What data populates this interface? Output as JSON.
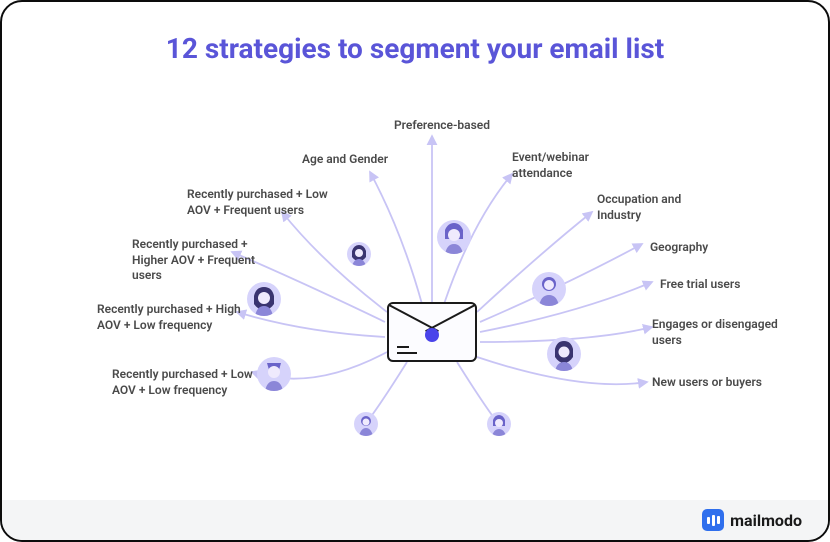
{
  "title": "12 strategies to segment your email list",
  "brand": "mailmodo",
  "colors": {
    "accent": "#5a55d8",
    "avatar_bg": "#d6d3fb",
    "line": "#c8c4f5"
  },
  "strategies": {
    "preference_based": "Preference-based",
    "age_gender": "Age and Gender",
    "recent_low_aov_freq": "Recently purchased + Low AOV + Frequent users",
    "recent_high_aov_freq": "Recently purchased + Higher AOV + Frequent users",
    "recent_high_aov_low": "Recently purchased + High AOV + Low frequency",
    "recent_low_aov_low": "Recently purchased + Low AOV + Low frequency",
    "event_webinar": "Event/webinar attendance",
    "occupation": "Occupation and Industry",
    "geography": "Geography",
    "free_trial": "Free trial users",
    "engaged": "Engages or disengaged users",
    "new_users": "New users or buyers"
  }
}
